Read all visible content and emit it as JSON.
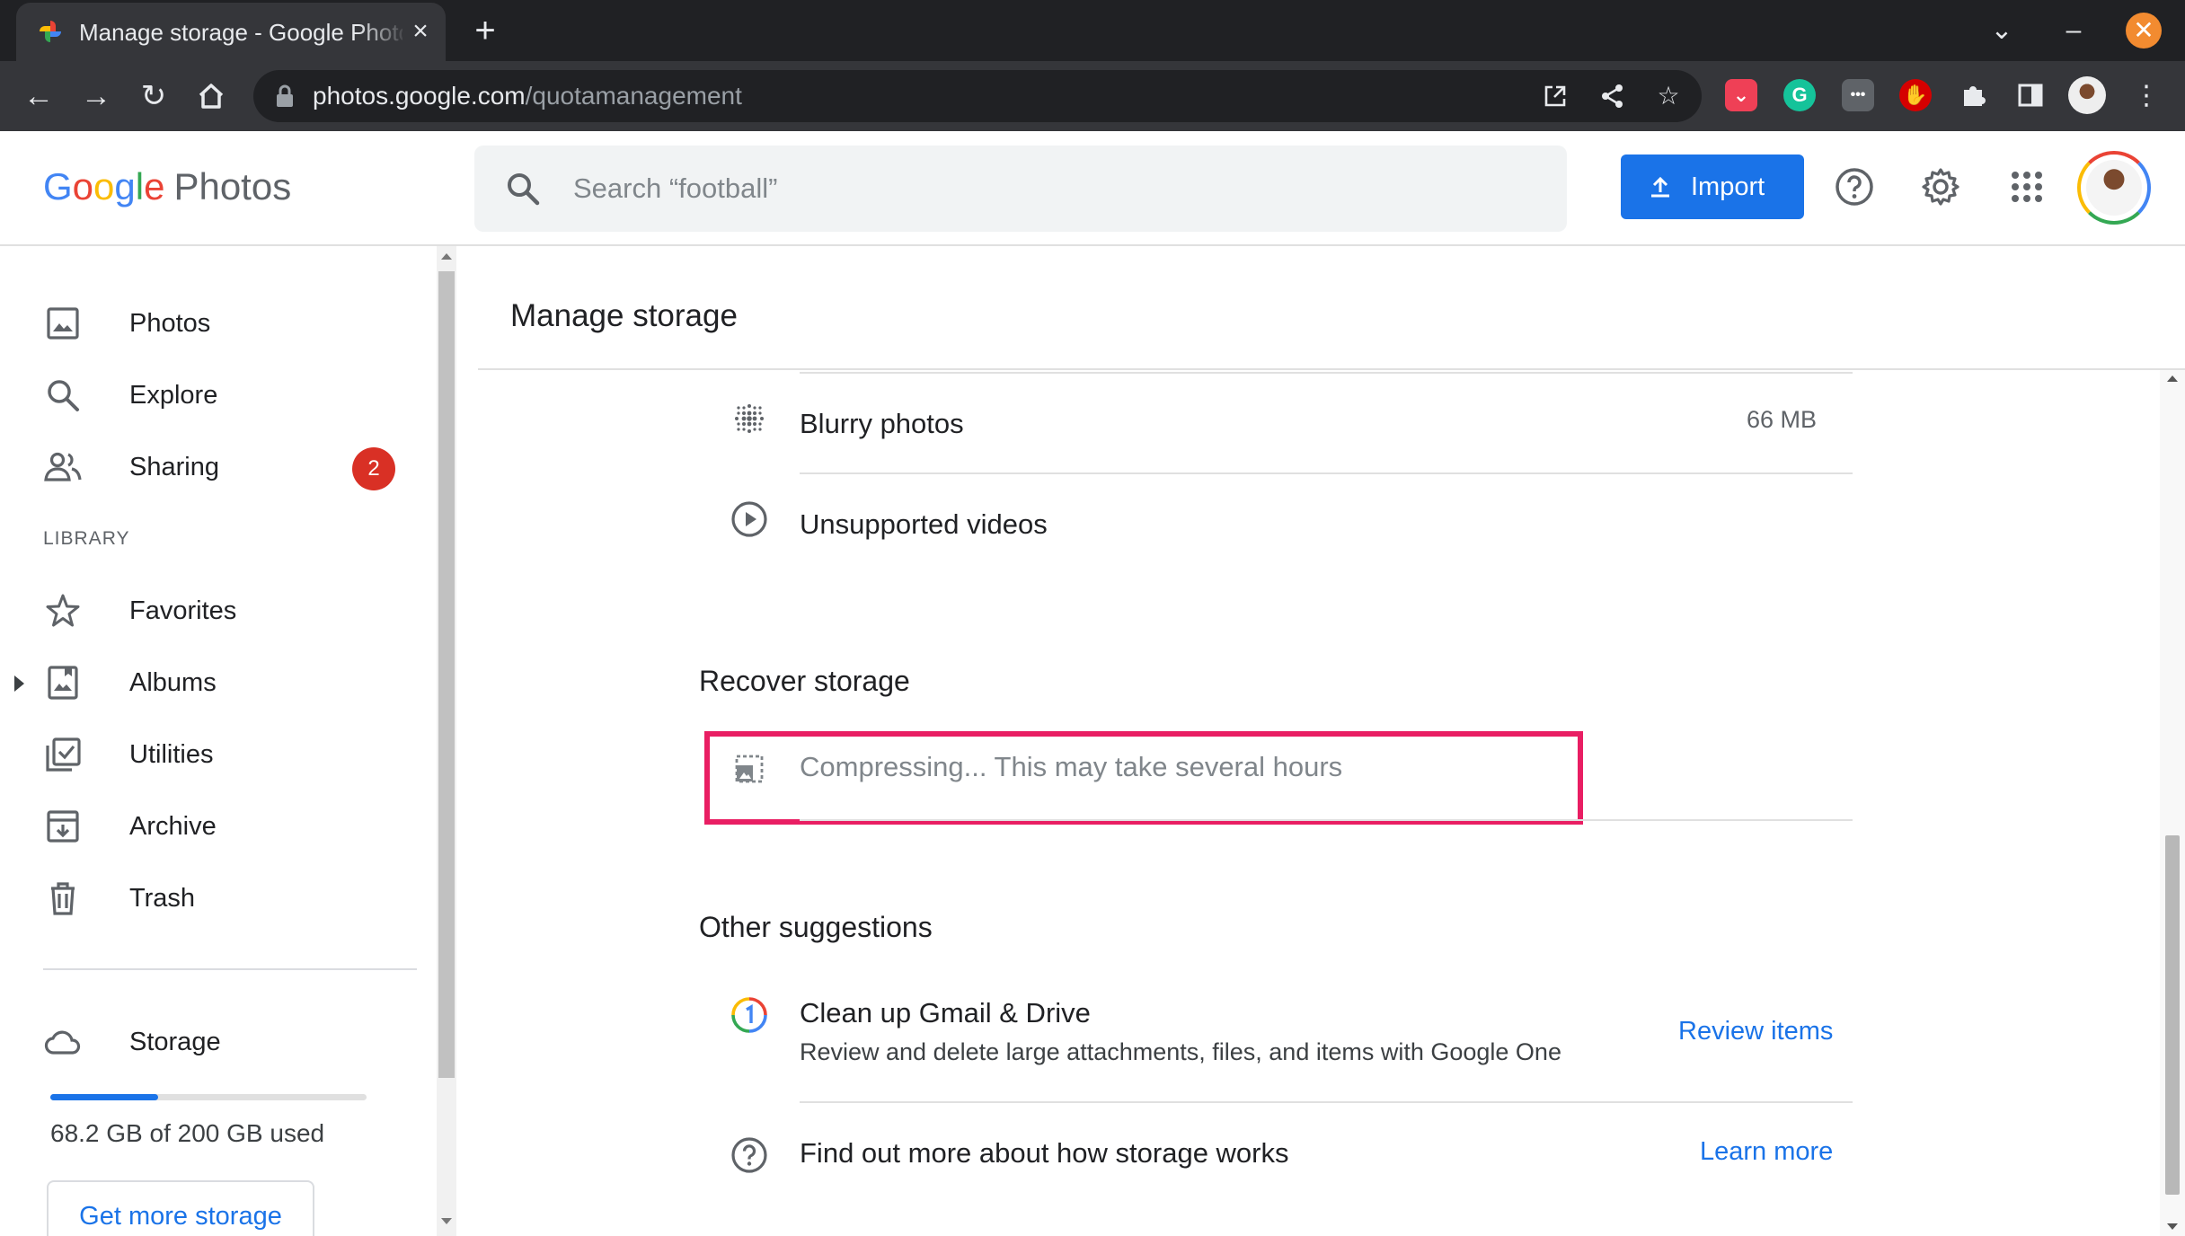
{
  "browser": {
    "tab_title": "Manage storage - Google Photos",
    "url_domain": "photos.google.com",
    "url_path": "/quotamanagement"
  },
  "header": {
    "logo_word": "Google",
    "logo_product": "Photos",
    "search_placeholder": "Search “football”",
    "import_label": "Import"
  },
  "sidebar": {
    "items": [
      {
        "label": "Photos",
        "icon": "photo-icon"
      },
      {
        "label": "Explore",
        "icon": "search-icon"
      },
      {
        "label": "Sharing",
        "icon": "people-icon",
        "badge": "2"
      }
    ],
    "library_heading": "LIBRARY",
    "library_items": [
      {
        "label": "Favorites",
        "icon": "star-icon"
      },
      {
        "label": "Albums",
        "icon": "album-icon"
      },
      {
        "label": "Utilities",
        "icon": "utilities-icon"
      },
      {
        "label": "Archive",
        "icon": "archive-icon"
      },
      {
        "label": "Trash",
        "icon": "trash-icon"
      }
    ],
    "storage_label": "Storage",
    "storage_used_text": "68.2 GB of 200 GB used",
    "storage_fraction": 0.341,
    "get_more_label": "Get more storage"
  },
  "main": {
    "title": "Manage storage",
    "review_rows": [
      {
        "label": "Blurry photos",
        "value": "66 MB",
        "icon": "blurry-photos-icon"
      },
      {
        "label": "Unsupported videos",
        "value": "",
        "icon": "play-circle-icon"
      }
    ],
    "recover_title": "Recover storage",
    "compress_status": "Compressing... This may take several hours",
    "other_title": "Other suggestions",
    "suggestions": [
      {
        "title": "Clean up Gmail & Drive",
        "subtitle": "Review and delete large attachments, files, and items with Google One",
        "action": "Review items",
        "icon": "google-one-icon"
      },
      {
        "title": "Find out more about how storage works",
        "action": "Learn more",
        "icon": "help-circle-icon"
      }
    ]
  },
  "colors": {
    "accent": "#1a73e8",
    "highlight": "#e91e63",
    "badge": "#d93025"
  }
}
